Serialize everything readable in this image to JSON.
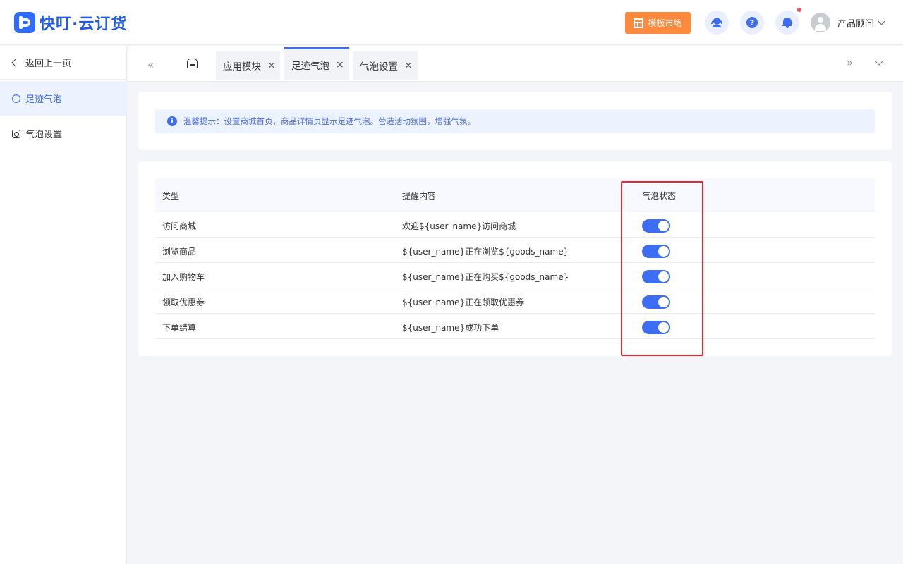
{
  "header": {
    "logo_text": "快叮·云订货",
    "market_button": "模板市场",
    "help_glyph": "?",
    "user_name": "产品顾问",
    "icons": [
      "customer-service-icon",
      "help-icon",
      "bell-icon",
      "avatar-icon",
      "chevron-down-icon"
    ],
    "accent_color": "#3d6df2",
    "market_color": "#ff8a3d",
    "notification_dot_color": "#f5475c"
  },
  "sidebar": {
    "back_label": "返回上一页",
    "items": [
      {
        "label": "足迹气泡",
        "icon": "chat-bubble-icon",
        "active": true
      },
      {
        "label": "气泡设置",
        "icon": "camera-icon",
        "active": false
      }
    ]
  },
  "tabs": {
    "nav_left": "«",
    "nav_right": "»",
    "items": [
      {
        "label": "应用模块",
        "close": "×",
        "active": false
      },
      {
        "label": "足迹气泡",
        "close": "×",
        "active": true
      },
      {
        "label": "气泡设置",
        "close": "×",
        "active": false
      }
    ]
  },
  "notice": {
    "info_glyph": "i",
    "text": "温馨提示：设置商城首页，商品详情页显示足迹气泡。营造活动氛围，增强气氛。"
  },
  "table": {
    "columns": [
      "类型",
      "提醒内容",
      "气泡状态"
    ],
    "rows": [
      {
        "type": "访问商城",
        "content": "欢迎${user_name}访问商城",
        "enabled": true
      },
      {
        "type": "浏览商品",
        "content": "${user_name}正在浏览${goods_name}",
        "enabled": true
      },
      {
        "type": "加入购物车",
        "content": "${user_name}正在购买${goods_name}",
        "enabled": true
      },
      {
        "type": "领取优惠券",
        "content": "${user_name}正在领取优惠券",
        "enabled": true
      },
      {
        "type": "下单结算",
        "content": "${user_name}成功下单",
        "enabled": true
      }
    ],
    "highlight_color": "#e8262b"
  }
}
